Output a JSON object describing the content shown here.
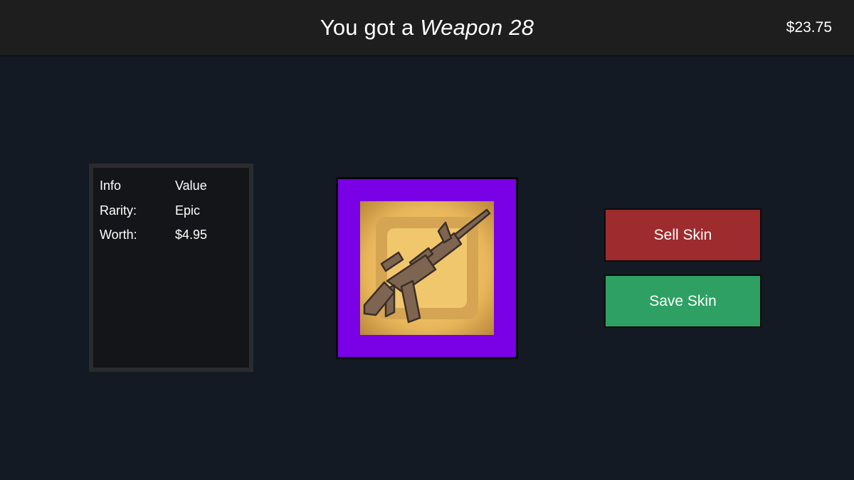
{
  "header": {
    "prefix": "You got a",
    "item_name": "Weapon 28",
    "balance": "$23.75"
  },
  "info_table": {
    "col_key": "Info",
    "col_value": "Value",
    "rows": [
      {
        "key": "Rarity:",
        "value": "Epic"
      },
      {
        "key": "Worth:",
        "value": "$4.95"
      }
    ]
  },
  "skin": {
    "icon": "rifle-icon",
    "rarity_color": "#7a00e6"
  },
  "actions": {
    "sell_label": "Sell Skin",
    "save_label": "Save Skin"
  },
  "colors": {
    "sell": "#9e2b2d",
    "save": "#2ea064",
    "background": "#131a24"
  }
}
